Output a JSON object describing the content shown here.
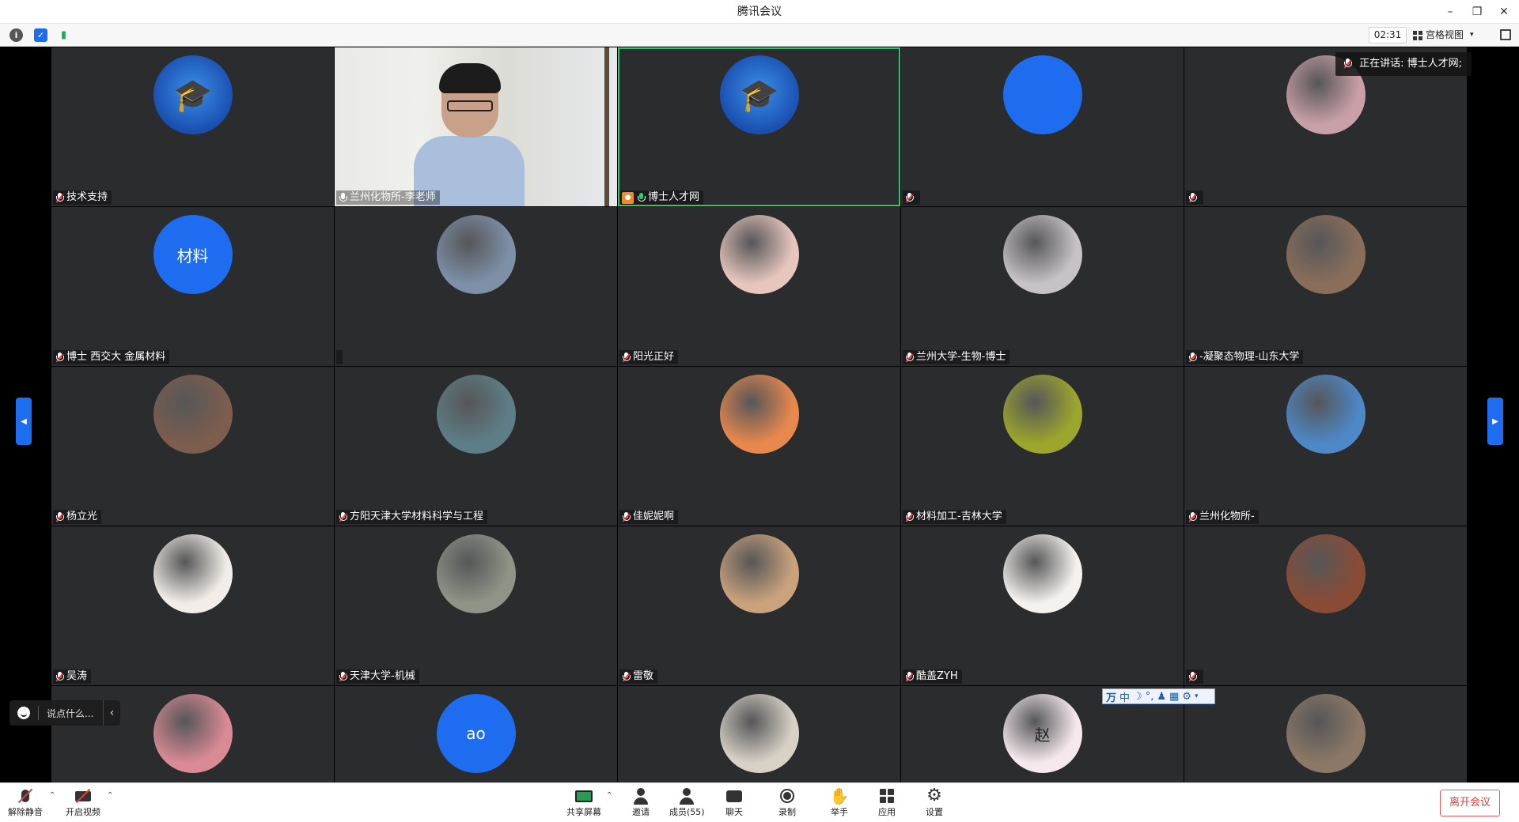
{
  "window": {
    "title": "腾讯会议"
  },
  "infobar": {
    "timer": "02:31",
    "view_label": "宫格视图"
  },
  "speaking_now": "正在讲话: 博士人才网;",
  "chat": {
    "placeholder": "说点什么..."
  },
  "participants": [
    {
      "name": "技术支持",
      "avatar_kind": "logo",
      "mic": "muted"
    },
    {
      "name": "兰州化物所-李老师",
      "avatar_kind": "video",
      "mic": "unmuted"
    },
    {
      "name": "博士人才网",
      "avatar_kind": "logo",
      "mic": "on",
      "host": true,
      "speaking": true
    },
    {
      "name": "",
      "avatar_kind": "blue",
      "avatar_text": "",
      "mic": "muted"
    },
    {
      "name": "",
      "avatar_kind": "photo",
      "color": "#c9a0a8",
      "mic": "muted"
    },
    {
      "name": "博士 西交大 金属材料",
      "avatar_kind": "blue",
      "avatar_text": "材料",
      "mic": "muted"
    },
    {
      "name": "",
      "avatar_kind": "photo",
      "color": "#7d90a8",
      "mic": "none"
    },
    {
      "name": "阳光正好",
      "avatar_kind": "photo",
      "color": "#e8c6bd",
      "mic": "muted"
    },
    {
      "name": "兰州大学-生物-博士",
      "avatar_kind": "photo",
      "color": "#c7c2c8",
      "mic": "muted"
    },
    {
      "name": "-凝聚态物理-山东大学",
      "avatar_kind": "photo",
      "color": "#8a6e5a",
      "mic": "muted"
    },
    {
      "name": "杨立光",
      "avatar_kind": "photo",
      "color": "#7c5d4e",
      "mic": "muted"
    },
    {
      "name": "方阳天津大学材料科学与工程",
      "avatar_kind": "photo",
      "color": "#5d7e86",
      "mic": "muted"
    },
    {
      "name": "佳妮妮啊",
      "avatar_kind": "photo",
      "color": "#e7884d",
      "mic": "muted"
    },
    {
      "name": "材料加工-吉林大学",
      "avatar_kind": "photo",
      "color": "#9ca52c",
      "mic": "muted"
    },
    {
      "name": "兰州化物所-",
      "avatar_kind": "photo",
      "color": "#4d88c7",
      "mic": "muted"
    },
    {
      "name": "吴涛",
      "avatar_kind": "photo",
      "color": "#f2ede8",
      "mic": "muted"
    },
    {
      "name": "天津大学-机械",
      "avatar_kind": "photo",
      "color": "#8f9486",
      "mic": "muted"
    },
    {
      "name": "雷敬",
      "avatar_kind": "photo",
      "color": "#caa27c",
      "mic": "muted"
    },
    {
      "name": "酷盖ZYH",
      "avatar_kind": "photo",
      "color": "#f4f1ee",
      "mic": "muted"
    },
    {
      "name": "",
      "avatar_kind": "photo",
      "color": "#8a4b35",
      "mic": "muted"
    },
    {
      "name": "",
      "avatar_kind": "photo",
      "color": "#d98a94",
      "mic": "none"
    },
    {
      "name": "",
      "avatar_kind": "blue",
      "avatar_text": "ao",
      "mic": "none"
    },
    {
      "name": "",
      "avatar_kind": "photo",
      "color": "#d8d2c6",
      "mic": "none"
    },
    {
      "name": "",
      "avatar_kind": "photo",
      "color": "#f6e9ee",
      "avatar_text": "赵",
      "mic": "none"
    },
    {
      "name": "",
      "avatar_kind": "photo",
      "color": "#8c7866",
      "mic": "none"
    }
  ],
  "toolbar": {
    "unmute": "解除静音",
    "start_video": "开启视频",
    "share_screen": "共享屏幕",
    "invite": "邀请",
    "members": "成员(55)",
    "chat": "聊天",
    "record": "录制",
    "raise_hand": "举手",
    "apps": "应用",
    "settings": "设置",
    "leave": "离开会议"
  },
  "ime": {
    "mode": "中"
  },
  "colors": {
    "accent": "#1e6cf0",
    "speaking": "#27c96b",
    "danger": "#e23c3c"
  }
}
